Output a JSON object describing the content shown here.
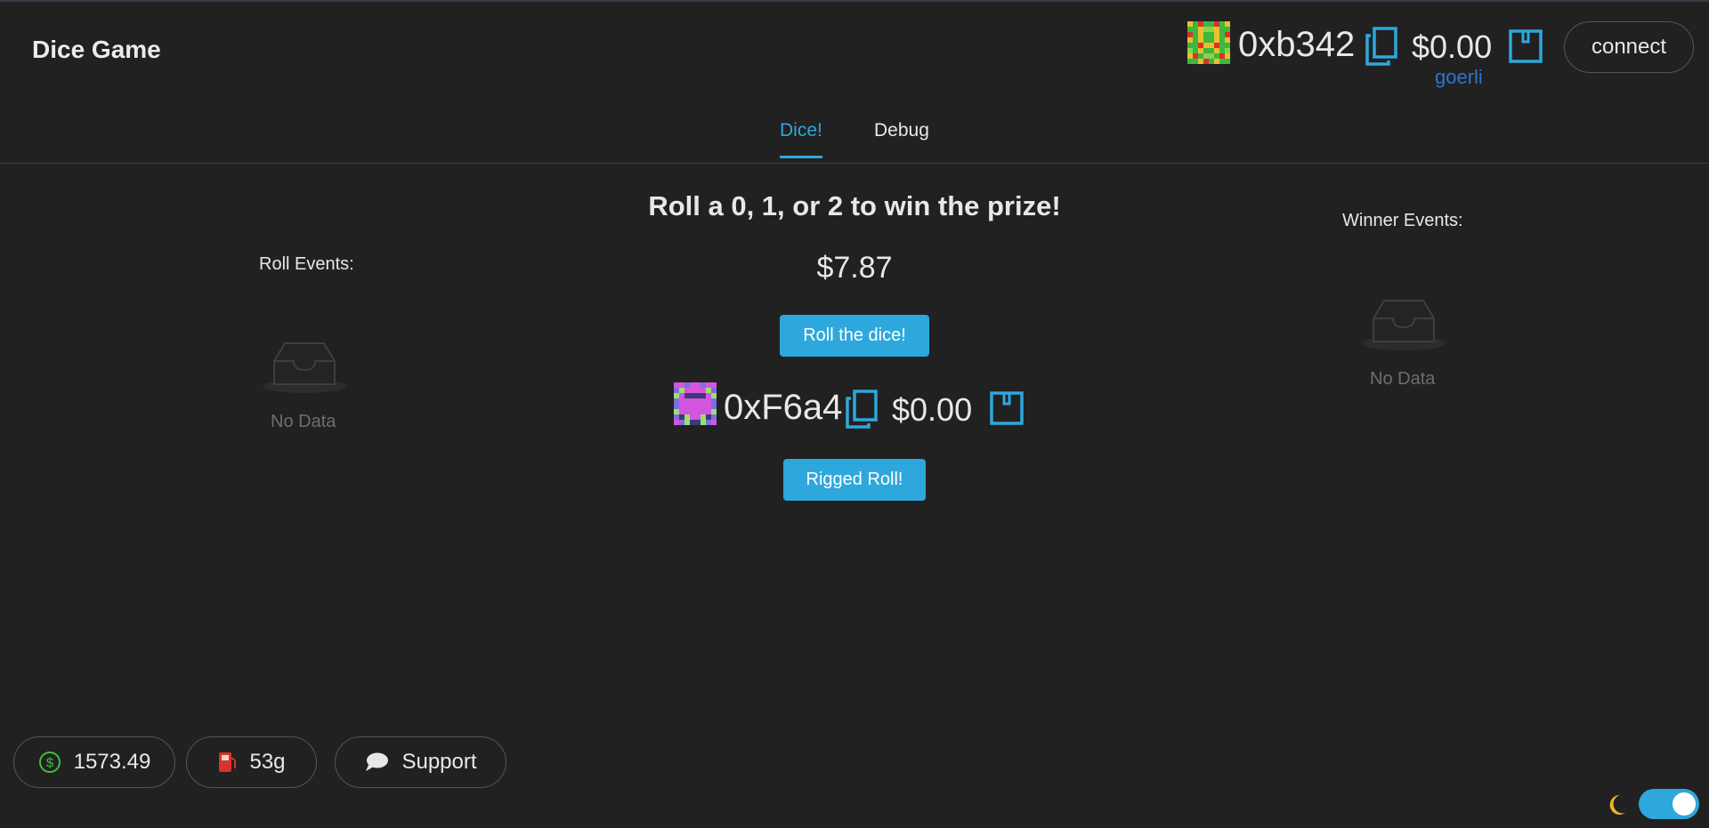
{
  "app": {
    "title": "Dice Game"
  },
  "header": {
    "account": {
      "address": "0xb342",
      "balance": "$0.00",
      "network": "goerli",
      "avatar": "blockie-icon"
    },
    "connect_label": "connect"
  },
  "tabs": [
    {
      "label": "Dice!",
      "active": true
    },
    {
      "label": "Debug",
      "active": false
    }
  ],
  "main": {
    "headline": "Roll a 0, 1, or 2 to win the prize!",
    "prize": "$7.87",
    "roll_button": "Roll the dice!",
    "rigged_account": {
      "address": "0xF6a4",
      "balance": "$0.00",
      "avatar": "blockie-icon"
    },
    "rigged_button": "Rigged Roll!"
  },
  "roll_events": {
    "title": "Roll Events:",
    "empty_text": "No Data"
  },
  "winner_events": {
    "title": "Winner Events:",
    "empty_text": "No Data"
  },
  "footer": {
    "price": "1573.49",
    "gas": "53g",
    "support_label": "Support"
  },
  "theme": {
    "dark_mode": true
  },
  "colors": {
    "accent": "#2ea8dc",
    "network": "#2f74d0",
    "background": "#212121",
    "price_icon": "#3cc13b",
    "gas_icon": "#d9322c",
    "moon_icon": "#f0b429"
  }
}
